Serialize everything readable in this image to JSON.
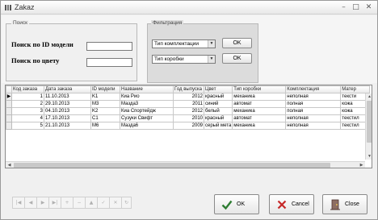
{
  "window": {
    "title": "Zakaz"
  },
  "search": {
    "legend": "Поиск",
    "id_label": "Поиск по ID модели",
    "color_label": "Поиск по цвету",
    "id_value": "",
    "color_value": ""
  },
  "filter": {
    "legend": "Фильтрация",
    "complectation_select": "Тип комплектации",
    "box_select": "Тип коробки",
    "ok1": "OK",
    "ok2": "OK"
  },
  "grid": {
    "columns": [
      "Код заказа",
      "Дата заказа",
      "ID модели",
      "Название",
      "Год выпуска",
      "Цвет",
      "Тип коробки",
      "Комплектация",
      "Матер"
    ],
    "rows": [
      [
        "1",
        "11.10.2013",
        "K1",
        "Киа Рио",
        "2012",
        "красный",
        "механика",
        "неполная",
        "тексти"
      ],
      [
        "2",
        "29.10.2013",
        "M3",
        "Мазда3",
        "2011",
        "синий",
        "автомат",
        "полная",
        "кожа"
      ],
      [
        "3",
        "04.10.2013",
        "K2",
        "Киа Спортейдж",
        "2012",
        "белый",
        "механика",
        "полная",
        "кожа"
      ],
      [
        "4",
        "17.10.2013",
        "C1",
        "Сузуки Свифт",
        "2010",
        "красный",
        "автомат",
        "неполная",
        "текстил"
      ],
      [
        "5",
        "21.10.2013",
        "M6",
        "Мазда6",
        "2009",
        "серый мета",
        "механика",
        "неполная",
        "текстил"
      ]
    ]
  },
  "buttons": {
    "ok": "OK",
    "cancel": "Cancel",
    "close": "Close"
  }
}
